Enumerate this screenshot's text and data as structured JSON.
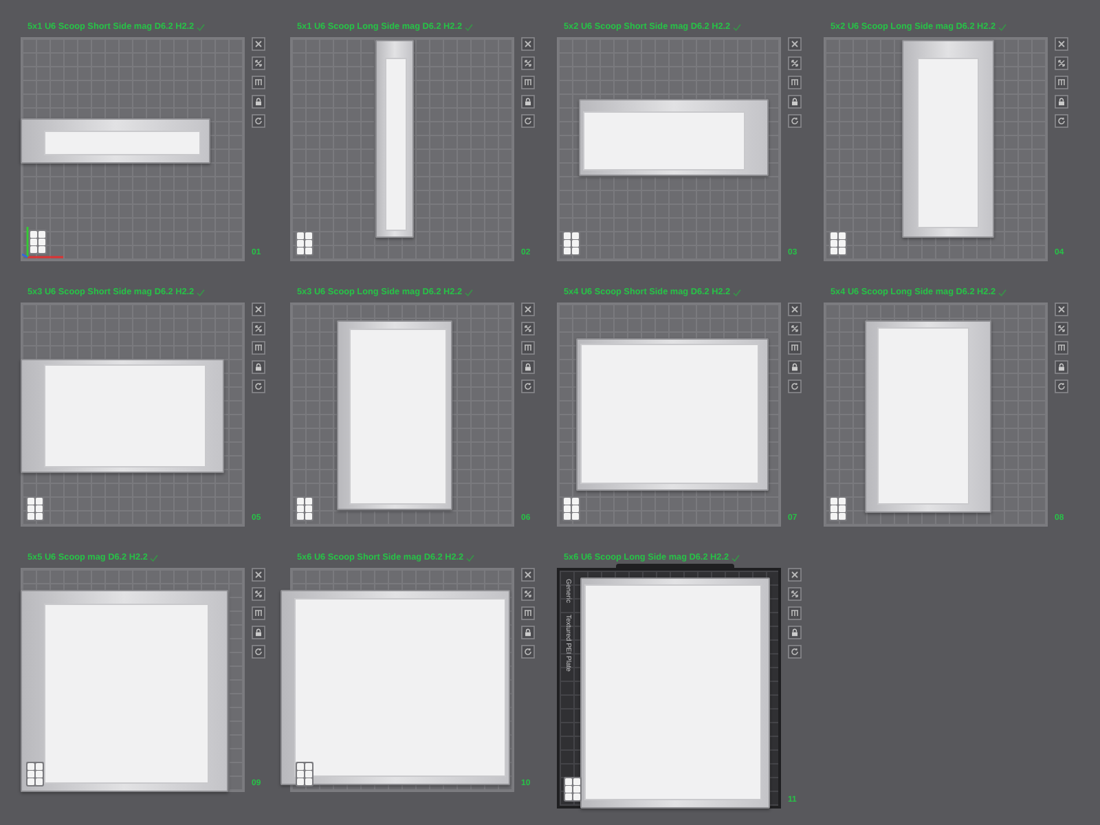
{
  "plates": [
    {
      "title": "5x1 U6 Scoop Short Side mag D6.2 H2.2",
      "number": "01",
      "kind": "smooth",
      "axes": true
    },
    {
      "title": "5x1 U6 Scoop Long Side mag D6.2 H2.2",
      "number": "02",
      "kind": "smooth",
      "axes": false
    },
    {
      "title": "5x2 U6 Scoop Short Side mag D6.2 H2.2",
      "number": "03",
      "kind": "smooth",
      "axes": false
    },
    {
      "title": "5x2 U6 Scoop Long Side mag D6.2 H2.2",
      "number": "04",
      "kind": "smooth",
      "axes": false
    },
    {
      "title": "5x3 U6 Scoop Short Side mag D6.2 H2.2",
      "number": "05",
      "kind": "smooth",
      "axes": false
    },
    {
      "title": "5x3 U6 Scoop Long Side mag D6.2 H2.2",
      "number": "06",
      "kind": "smooth",
      "axes": false
    },
    {
      "title": "5x4 U6 Scoop Short Side mag D6.2 H2.2",
      "number": "07",
      "kind": "smooth",
      "axes": false
    },
    {
      "title": "5x4 U6 Scoop Long Side mag D6.2 H2.2",
      "number": "08",
      "kind": "smooth",
      "axes": false
    },
    {
      "title": "5x5 U6 Scoop mag D6.2 H2.2",
      "number": "09",
      "kind": "smooth",
      "axes": false
    },
    {
      "title": "5x6 U6 Scoop Short Side mag D6.2 H2.2",
      "number": "10",
      "kind": "smooth",
      "axes": false
    },
    {
      "title": "5x6 U6 Scoop Long Side mag D6.2 H2.2",
      "number": "11",
      "kind": "textured",
      "axes": false,
      "plate_labels": [
        "Generic",
        "Textured PEI Plate"
      ]
    }
  ]
}
